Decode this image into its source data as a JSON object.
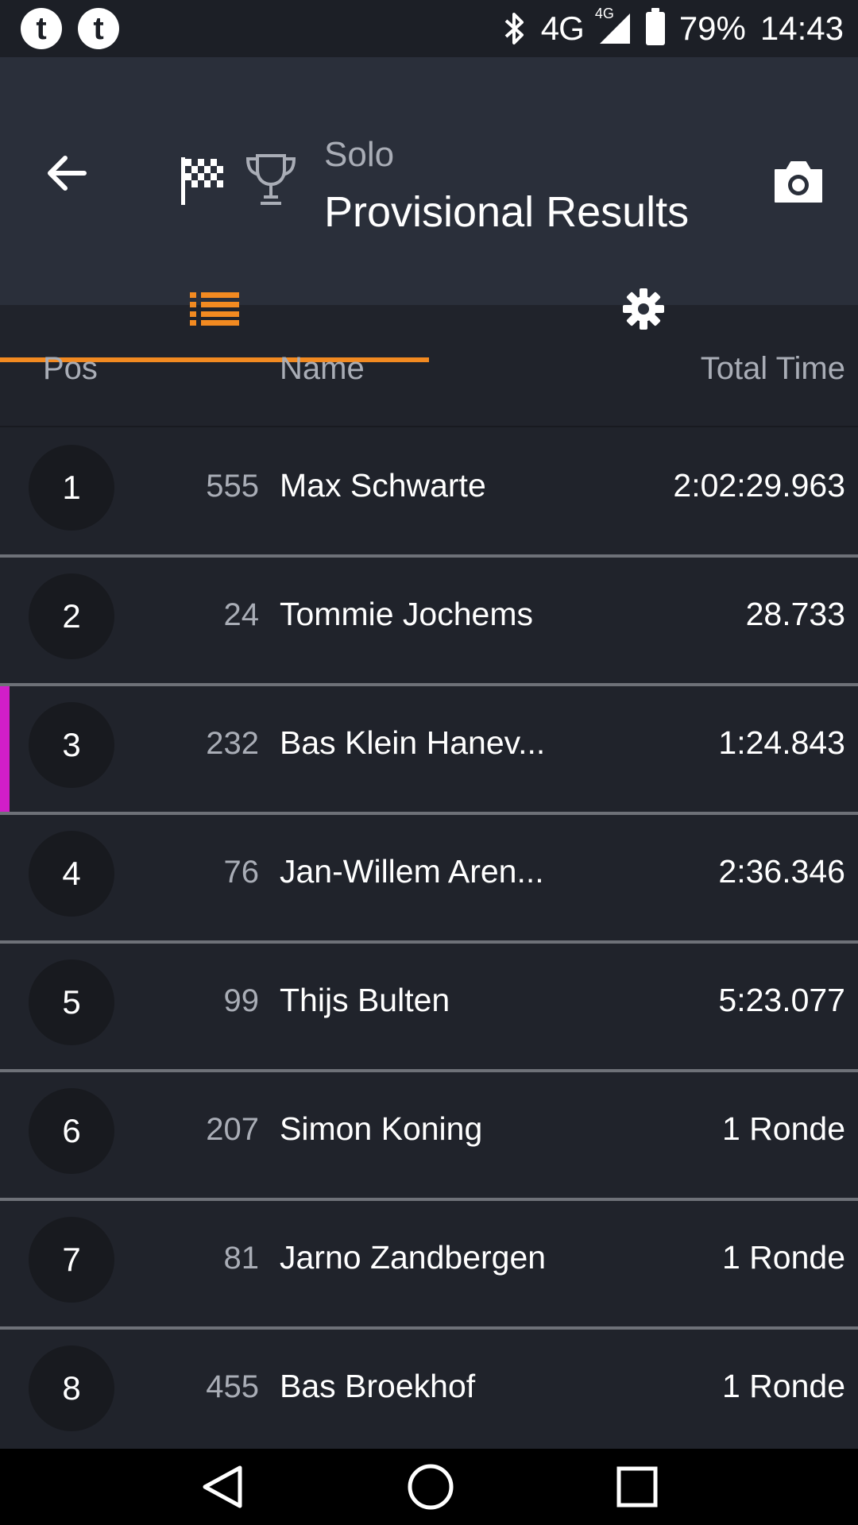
{
  "status_bar": {
    "app_icon_1": "t",
    "app_icon_2": "t",
    "network": "4G",
    "network_small": "4G",
    "battery": "79%",
    "time": "14:43"
  },
  "header": {
    "subtitle": "Solo",
    "title": "Provisional Results"
  },
  "tabs": [
    {
      "icon": "list-icon",
      "active": true
    },
    {
      "icon": "gear-icon",
      "active": false
    }
  ],
  "table": {
    "columns": {
      "pos": "Pos",
      "name": "Name",
      "time": "Total Time"
    },
    "rows": [
      {
        "pos": "1",
        "bib": "555",
        "name": "Max Schwarte",
        "time": "2:02:29.963"
      },
      {
        "pos": "2",
        "bib": "24",
        "name": "Tommie Jochems",
        "time": "28.733"
      },
      {
        "pos": "3",
        "bib": "232",
        "name": "Bas Klein Hanev...",
        "time": "1:24.843"
      },
      {
        "pos": "4",
        "bib": "76",
        "name": "Jan-Willem Aren...",
        "time": "2:36.346"
      },
      {
        "pos": "5",
        "bib": "99",
        "name": "Thijs Bulten",
        "time": "5:23.077"
      },
      {
        "pos": "6",
        "bib": "207",
        "name": "Simon Koning",
        "time": "1 Ronde"
      },
      {
        "pos": "7",
        "bib": "81",
        "name": "Jarno Zandbergen",
        "time": "1 Ronde"
      },
      {
        "pos": "8",
        "bib": "455",
        "name": "Bas Broekhof",
        "time": "1 Ronde"
      }
    ]
  },
  "colors": {
    "accent": "#f28a21",
    "highlight": "#d11ec8",
    "background": "#20232b",
    "app_bar": "#2a2f3a"
  }
}
